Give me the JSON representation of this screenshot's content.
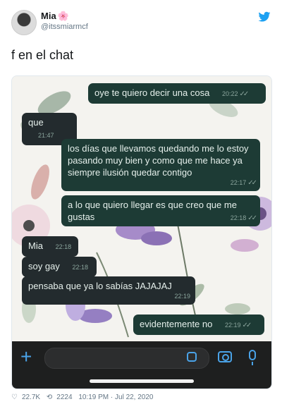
{
  "tweet": {
    "display_name": "Mia",
    "name_emoji": "🌸",
    "handle": "@itssmiarmcf",
    "text": "f en el chat"
  },
  "chat": {
    "messages": [
      {
        "dir": "out",
        "text": "oye te quiero decir una cosa",
        "time": "20:22",
        "ticks": "✓✓"
      },
      {
        "dir": "in",
        "text": "que",
        "time": "21:47"
      },
      {
        "dir": "out",
        "text": "los días que llevamos quedando me lo estoy pasando muy bien y como que me hace ya siempre ilusión quedar contigo",
        "time": "22:17",
        "ticks": "✓✓"
      },
      {
        "dir": "out",
        "text": "a lo que quiero llegar es que creo que me gustas",
        "time": "22:18",
        "ticks": "✓✓"
      },
      {
        "dir": "in",
        "text": "Mia",
        "time": "22:18"
      },
      {
        "dir": "in",
        "text": "soy gay",
        "time": "22:18"
      },
      {
        "dir": "in",
        "text": "pensaba que ya lo sabías JAJAJAJ",
        "time": "22:19"
      },
      {
        "dir": "out",
        "text": "evidentemente no",
        "time": "22:19",
        "ticks": "✓✓"
      }
    ]
  },
  "footer": {
    "likes": "22.7K",
    "retweets": "2224",
    "timestamp": "10:19 PM · Jul 22, 2020"
  },
  "colors": {
    "outgoing_bubble": "#1d3b35",
    "incoming_bubble": "#232b2e",
    "accent_blue": "#4aa3e8",
    "twitter_blue": "#1da1f2"
  },
  "icons": [
    "twitter-bird-icon",
    "plus-icon",
    "sticker-icon",
    "camera-icon",
    "microphone-icon",
    "heart-icon",
    "retweet-icon"
  ]
}
